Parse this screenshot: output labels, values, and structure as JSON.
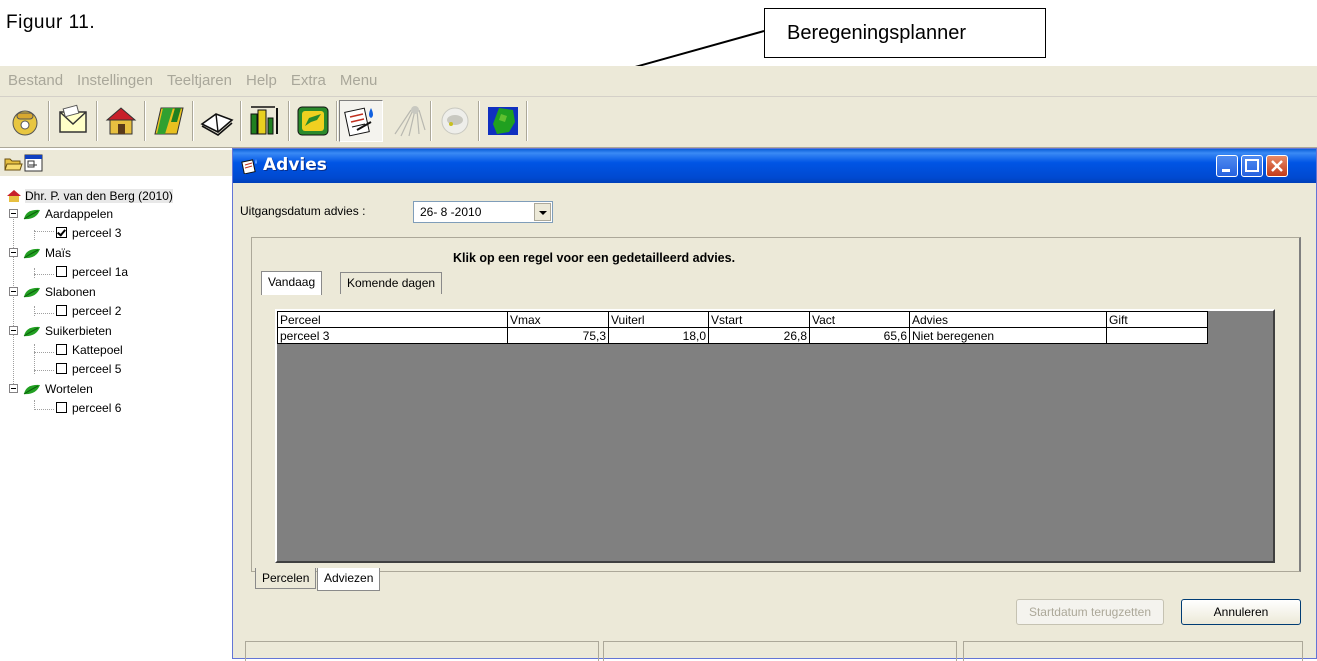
{
  "document": {
    "caption": "Figuur 11.",
    "callout_label": "Beregeningsplanner"
  },
  "menubar": {
    "items": [
      "Bestand",
      "Instellingen",
      "Teeltjaren",
      "Help",
      "Extra",
      "Menu"
    ]
  },
  "toolbar": {
    "icons": [
      "phone-icon",
      "mail-icon",
      "farm-icon",
      "field-icon",
      "book-icon",
      "chart-icon",
      "john-deere-icon",
      "irrigation-planner-icon",
      "sprinkler-icon",
      "weather-icon",
      "map-icon"
    ]
  },
  "tree": {
    "root": "Dhr. P. van den Berg (2010)",
    "crops": [
      {
        "name": "Aardappelen",
        "fields": [
          {
            "name": "perceel 3",
            "checked": true
          }
        ]
      },
      {
        "name": "Maïs",
        "fields": [
          {
            "name": "perceel 1a",
            "checked": false
          }
        ]
      },
      {
        "name": "Slabonen",
        "fields": [
          {
            "name": "perceel 2",
            "checked": false
          }
        ]
      },
      {
        "name": "Suikerbieten",
        "fields": [
          {
            "name": "Kattepoel",
            "checked": false
          },
          {
            "name": "perceel 5",
            "checked": false
          }
        ]
      },
      {
        "name": "Wortelen",
        "fields": [
          {
            "name": "perceel 6",
            "checked": false
          }
        ]
      }
    ]
  },
  "window": {
    "title": "Advies",
    "date_label": "Uitgangsdatum advies :",
    "date_value": "26- 8 -2010",
    "instruction": "Klik op een regel voor een gedetailleerd advies.",
    "top_tabs": [
      "Vandaag",
      "Komende dagen"
    ],
    "bottom_tabs": [
      "Percelen",
      "Adviezen"
    ],
    "buttons": {
      "startdatum": "Startdatum terugzetten",
      "annuleren": "Annuleren"
    }
  },
  "grid": {
    "columns": [
      "Perceel",
      "Vmax",
      "Vuiterl",
      "Vstart",
      "Vact",
      "Advies",
      "Gift"
    ],
    "rows": [
      [
        "perceel 3",
        "75,3",
        "18,0",
        "26,8",
        "65,6",
        "Niet beregenen",
        ""
      ]
    ]
  },
  "colors": {
    "titlebar": "#0055e5",
    "chrome": "#ece9d8",
    "grid_background": "#808080",
    "disabled_text": "#aca899"
  }
}
